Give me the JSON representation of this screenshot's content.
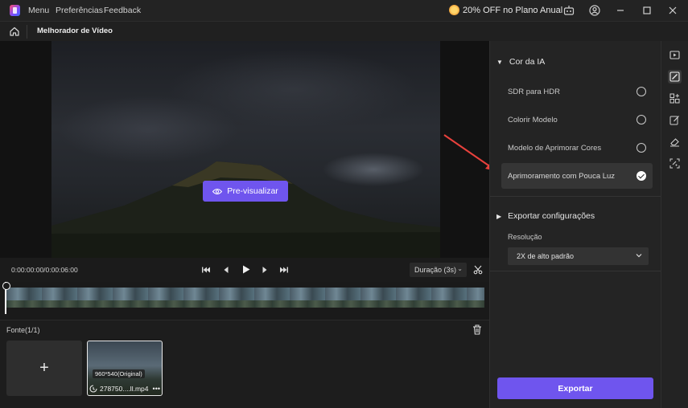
{
  "titlebar": {
    "menu_items": [
      "Menu",
      "Preferências",
      "Feedback"
    ],
    "promo_text": "20% OFF no Plano Anual"
  },
  "subbar": {
    "title": "Melhorador de Vídeo"
  },
  "preview": {
    "button_label": "Pre-visualizar"
  },
  "controls": {
    "timecode": "0:00:00:00/0:00:06:00",
    "duration_label": "Duração (3s)"
  },
  "source": {
    "title": "Fonte(1/1)",
    "add_label": "+",
    "clip": {
      "resolution": "960*540(Original)",
      "name": "278750....ll.mp4",
      "more": "•••"
    }
  },
  "right_panel": {
    "ai_color_section": "Cor da IA",
    "options": [
      {
        "label": "SDR para HDR",
        "selected": false
      },
      {
        "label": "Colorir Modelo",
        "selected": false
      },
      {
        "label": "Modelo de Aprimorar Cores",
        "selected": false
      },
      {
        "label": "Aprimoramento com Pouca Luz",
        "selected": true
      }
    ],
    "export_section": "Exportar configurações",
    "resolution_label": "Resolução",
    "resolution_value": "2X de alto padrão",
    "export_button": "Exportar"
  },
  "colors": {
    "accent": "#6f55ee",
    "annotation_arrow": "#e8413c"
  },
  "icons": [
    "home-icon",
    "eye-icon",
    "skip-start-icon",
    "step-back-icon",
    "play-icon",
    "step-forward-icon",
    "skip-end-icon",
    "scissors-icon",
    "trash-icon",
    "gift-icon",
    "user-icon",
    "minimize-icon",
    "maximize-icon",
    "close-icon"
  ]
}
